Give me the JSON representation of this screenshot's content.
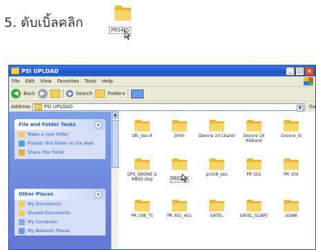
{
  "instruction": {
    "text": "5. ดับเบิ้ลคลิก",
    "folder_label": "PR54FS"
  },
  "window": {
    "title": "PSI UPLOAD",
    "buttons": {
      "minimize": "_",
      "maximize": "□",
      "close": "x"
    },
    "menu": [
      "File",
      "Edit",
      "View",
      "Favorites",
      "Tools",
      "Help"
    ],
    "toolbar": {
      "back": "Back",
      "search": "Search",
      "folders": "Folders"
    },
    "address": {
      "label": "Address",
      "value": "PSI UPLOAD",
      "go": "Go"
    }
  },
  "left_pane": {
    "tasks_panel": {
      "title": "File and Folder Tasks",
      "items": [
        "Make a new folder",
        "Publish this folder to the Web",
        "Share this folder"
      ]
    },
    "places_panel": {
      "title": "Other Places",
      "items": [
        "My Documents",
        "Shared Documents",
        "My Computer",
        "My Network Places"
      ]
    }
  },
  "files": [
    "Dfc_bes 6",
    "Drtm",
    "Dxovre 14 Cband",
    "Dxovre 16 KUband",
    "Dxovre_IS",
    "GPS_DRONE & MB62 Dop",
    "PR54FS",
    "pr108_ses",
    "PR 102",
    "PR 104",
    "PR 108_T5",
    "PR 301_401",
    "SATEL",
    "SATEL_SCART",
    "SISAR"
  ],
  "selected_file": "PR54FS"
}
